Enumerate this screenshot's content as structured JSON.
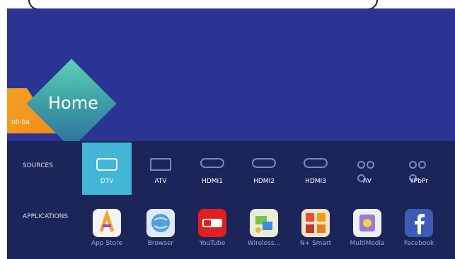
{
  "header": {
    "home_title": "Home",
    "clock": "00:04"
  },
  "sources": {
    "row_label": "SOURCES",
    "items": [
      {
        "label": "DTV",
        "icon": "dtv-icon",
        "selected": true
      },
      {
        "label": "ATV",
        "icon": "tv-icon",
        "selected": false
      },
      {
        "label": "HDMI1",
        "icon": "hdmi-icon",
        "selected": false
      },
      {
        "label": "HDMI2",
        "icon": "hdmi-icon",
        "selected": false
      },
      {
        "label": "HDMI3",
        "icon": "hdmi-icon",
        "selected": false
      },
      {
        "label": "AV",
        "icon": "av-icon",
        "selected": false
      },
      {
        "label": "YPbPr",
        "icon": "ypbpr-icon",
        "selected": false
      }
    ]
  },
  "applications": {
    "row_label": "APPLICATIONS",
    "items": [
      {
        "label": "App Store",
        "icon": "app-store-icon"
      },
      {
        "label": "Browser",
        "icon": "browser-icon"
      },
      {
        "label": "YouTube",
        "icon": "youtube-icon"
      },
      {
        "label": "Wireless...",
        "icon": "wireless-icon"
      },
      {
        "label": "N+ Smart",
        "icon": "n-smart-icon"
      },
      {
        "label": "MultiMedia",
        "icon": "multimedia-icon"
      },
      {
        "label": "Facebook",
        "icon": "facebook-icon"
      }
    ]
  },
  "colors": {
    "background": "#2a3593",
    "bottom_bar": "#1c2558",
    "selected_tile": "#43b6d6",
    "accent_orange": "#f5a024",
    "diamond_teal": "#3ea3a6"
  }
}
